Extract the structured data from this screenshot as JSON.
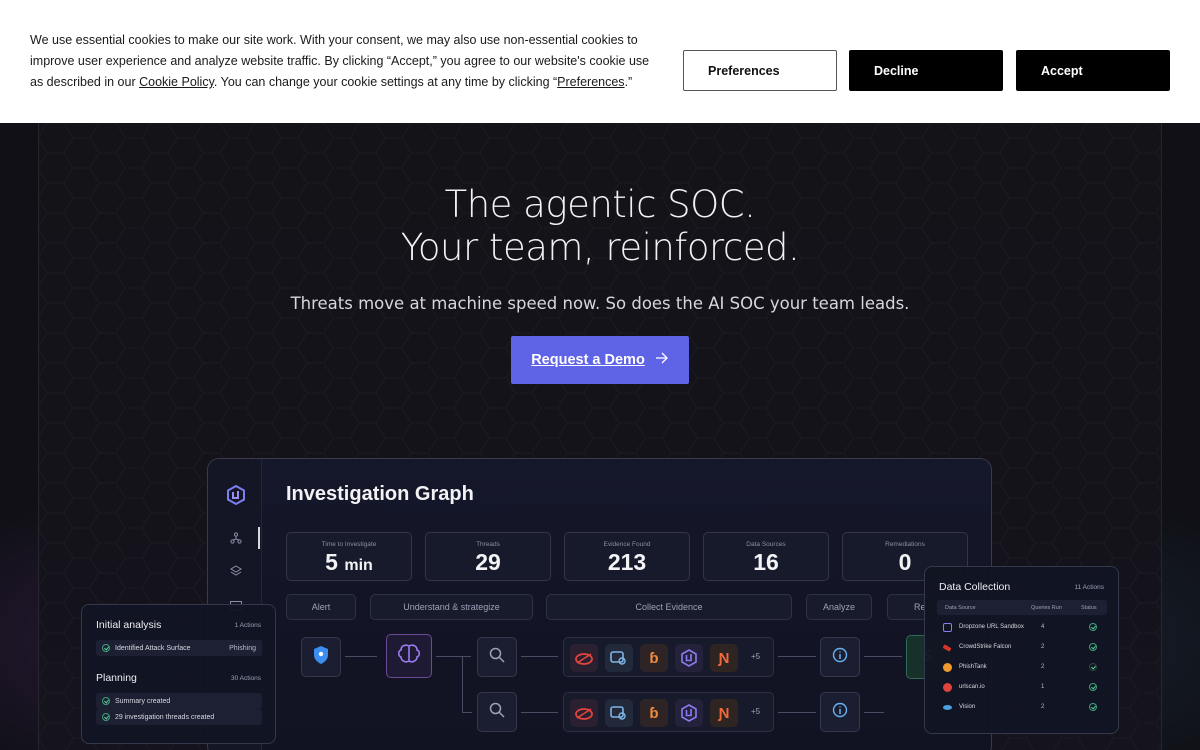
{
  "cookie_banner": {
    "text_part1": "We use essential cookies to make our site work. With your consent, we may also use non-essential cookies to improve user experience and analyze website traffic. By clicking “Accept,” you agree to our website's cookie use as described in our ",
    "cookie_policy_link": "Cookie Policy",
    "text_part2": ". You can change your cookie settings at any time by clicking “",
    "preferences_link": "Preferences",
    "text_part3": ".”",
    "buttons": {
      "preferences": "Preferences",
      "decline": "Decline",
      "accept": "Accept"
    }
  },
  "hero": {
    "title_line1": "The agentic SOC.",
    "title_line2": "Your team, reinforced.",
    "subtitle": "Threats move at machine speed now. So does the AI SOC your team leads.",
    "cta_label": "Request a Demo",
    "cta_icon": "arrow-right-icon"
  },
  "dashboard": {
    "title": "Investigation Graph",
    "sidebar_icons": [
      "logo-icon",
      "graph-icon",
      "layers-icon",
      "table-icon"
    ],
    "stats": [
      {
        "label": "Time to Investigate",
        "value": "5",
        "unit": "min"
      },
      {
        "label": "Threads",
        "value": "29",
        "unit": ""
      },
      {
        "label": "Evidence Found",
        "value": "213",
        "unit": ""
      },
      {
        "label": "Data Sources",
        "value": "16",
        "unit": ""
      },
      {
        "label": "Remediations",
        "value": "0",
        "unit": ""
      }
    ],
    "phases": [
      "Alert",
      "Understand & strategize",
      "Collect Evidence",
      "Analyze",
      "Re"
    ],
    "more_count": "+5"
  },
  "panel_left": {
    "section1_title": "Initial analysis",
    "section1_count": "1 Actions",
    "section1_item": "Identified Attack Surface",
    "section1_tag": "Phishing",
    "section2_title": "Planning",
    "section2_count": "30 Actions",
    "section2_items": [
      "Summary created",
      "29 investigation threads created"
    ]
  },
  "panel_right": {
    "title": "Data Collection",
    "count": "11 Actions",
    "headers": {
      "source": "Data Source",
      "queries": "Queries Run",
      "status": "Status"
    },
    "rows": [
      {
        "name": "Dropzone URL Sandbox",
        "queries": "4"
      },
      {
        "name": "CrowdStrike Falcon",
        "queries": "2"
      },
      {
        "name": "PhishTank",
        "queries": "2"
      },
      {
        "name": "urlscan.io",
        "queries": "1"
      },
      {
        "name": "Vision",
        "queries": "2"
      }
    ]
  },
  "colors": {
    "cta": "#5f63e6",
    "page_bg": "#101016",
    "panel_bg": "#121522",
    "success": "#3aa57a"
  }
}
